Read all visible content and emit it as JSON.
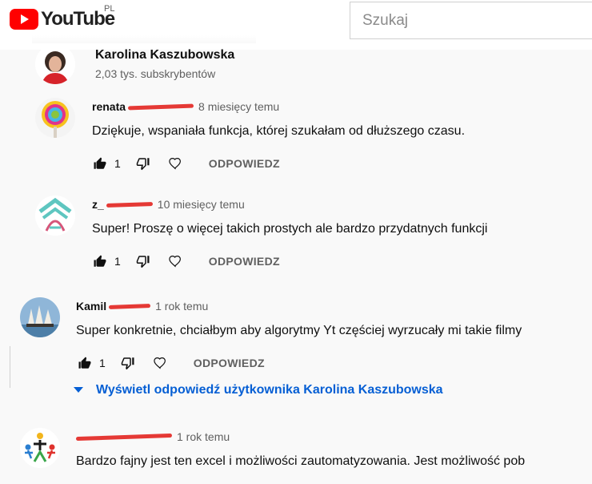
{
  "masthead": {
    "logo_text": "YouTube",
    "region": "PL",
    "search_placeholder": "Szukaj",
    "brand_color": "#ff0000"
  },
  "channel": {
    "name": "Karolina Kaszubowska",
    "subscribers": "2,03 tys. subskrybentów"
  },
  "actions": {
    "reply_label": "ODPOWIEDZ",
    "like_icon": "thumb-up-icon",
    "dislike_icon": "thumb-down-icon",
    "heart_icon": "heart-icon"
  },
  "comments": [
    {
      "author": "renata",
      "time": "8 miesięcy temu",
      "text": "Dziękuje, wspaniała funkcja, której szukałam od dłuższego czasu.",
      "likes": "1"
    },
    {
      "author": "z_",
      "time": "10 miesięcy temu",
      "text": "Super! Proszę o więcej takich prostych ale bardzo przydatnych funkcji",
      "likes": "1"
    },
    {
      "author": "Kamil",
      "time": "1 rok temu",
      "text": "Super konkretnie, chciałbym aby algorytmy Yt częściej wyrzucały mi takie filmy",
      "likes": "1"
    },
    {
      "author": "",
      "time": "1 rok temu",
      "text": "Bardzo fajny jest ten excel i możliwości zautomatyzowania. Jest możliwość pob",
      "likes": ""
    }
  ],
  "view_replies": "Wyświetl odpowiedź użytkownika Karolina Kaszubowska",
  "link_color": "#065fd4",
  "redaction_color": "#e53935"
}
